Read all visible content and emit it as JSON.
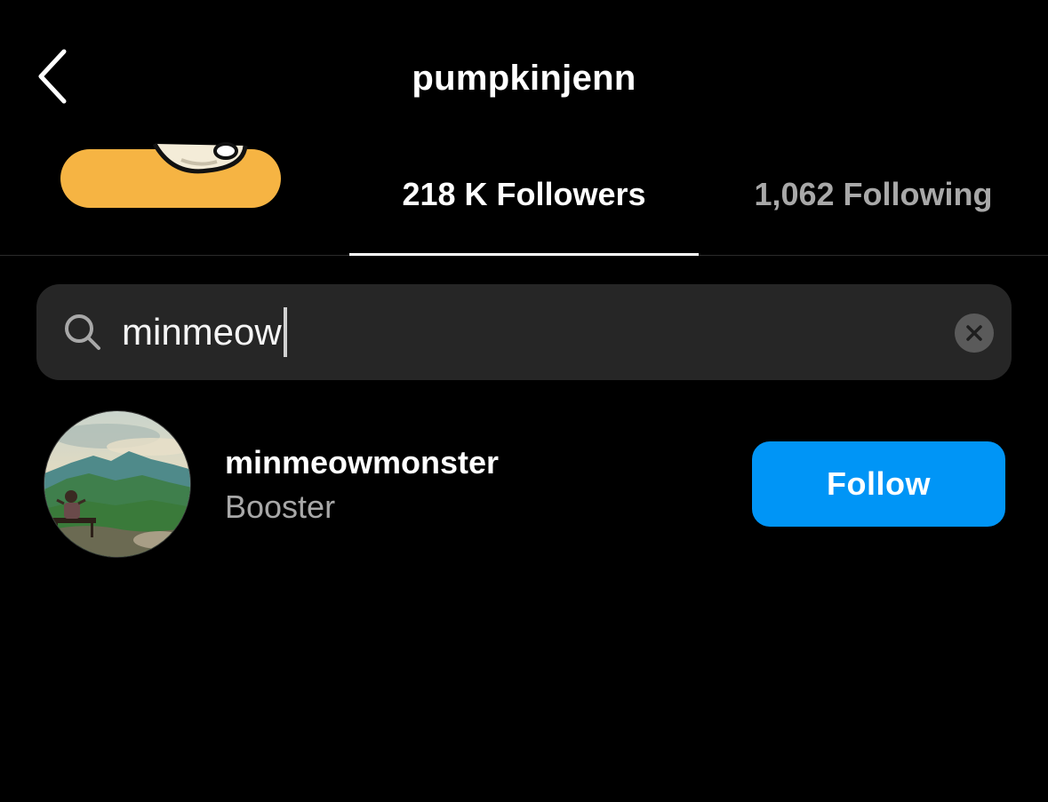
{
  "header": {
    "title": "pumpkinjenn",
    "back_icon": "chevron-left-icon"
  },
  "tabs": {
    "subscribers_label": "",
    "followers_label": "218 K Followers",
    "following_label": "1,062 Following",
    "active": "followers"
  },
  "search": {
    "value": "minmeow",
    "search_icon": "search-icon",
    "clear_icon": "clear-icon"
  },
  "results": [
    {
      "username": "minmeowmonster",
      "subtitle": "Booster",
      "button_label": "Follow"
    }
  ],
  "colors": {
    "background": "#000000",
    "search_bg": "#262626",
    "follow_button": "#0095f6",
    "secondary_text": "#a8a8a8",
    "redaction": "#f6b443"
  }
}
